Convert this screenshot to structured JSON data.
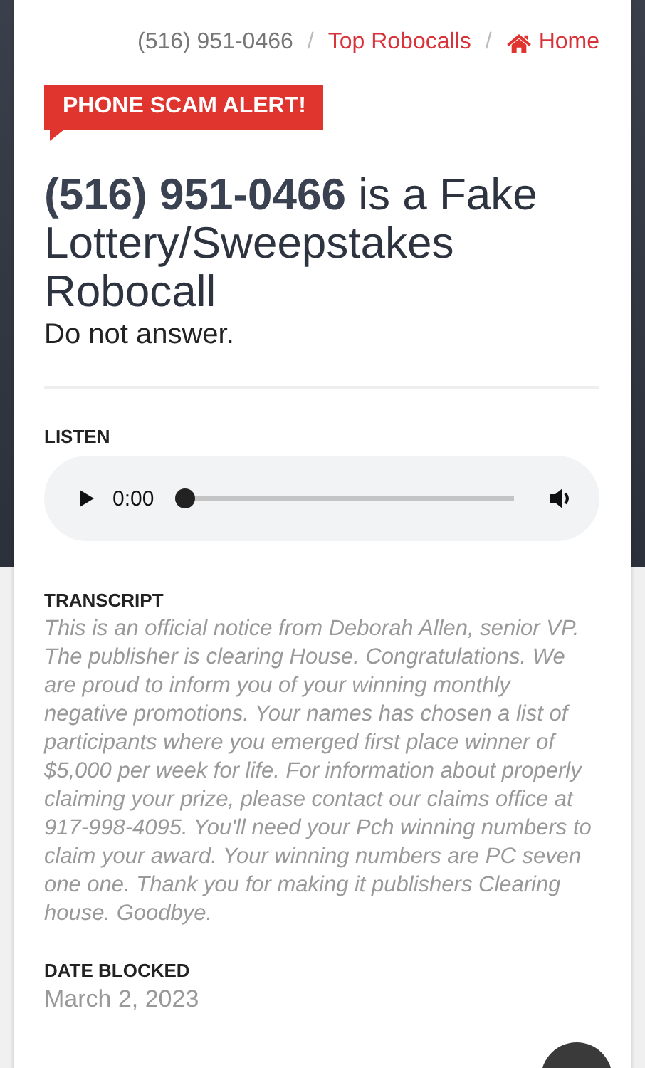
{
  "breadcrumb": [
    {
      "label": "(516) 951-0466",
      "kind": "current"
    },
    {
      "label": "Top Robocalls",
      "kind": "link",
      "separator": "/"
    },
    {
      "label": "Home",
      "kind": "home",
      "separator": "/"
    }
  ],
  "alert_tag": "PHONE SCAM ALERT!",
  "heading": "**(516) 951-0466** is a Fake Lottery/Sweepstakes Robocall",
  "subheading": "Do not answer.",
  "listen": {
    "label": "LISTEN",
    "time": "0:00",
    "level": 0
  },
  "transcript": {
    "label": "TRANSCRIPT",
    "text": "This is an official notice from Deborah Allen, senior VP. The publisher is clearing House. Congratulations. We are proud to inform you of your winning monthly negative promotions. Your names has chosen a list of participants where you emerged first place winner of $5,000 per week for life. For information about properly claiming your prize, please contact our claims office at 917-998-4095. You'll need your Pch winning numbers to claim your award. Your winning numbers are PC seven one one. Thank you for making it publishers Clearing house. Goodbye."
  },
  "date_blocked": {
    "label": "DATE BLOCKED",
    "value": "March 2, 2023"
  }
}
